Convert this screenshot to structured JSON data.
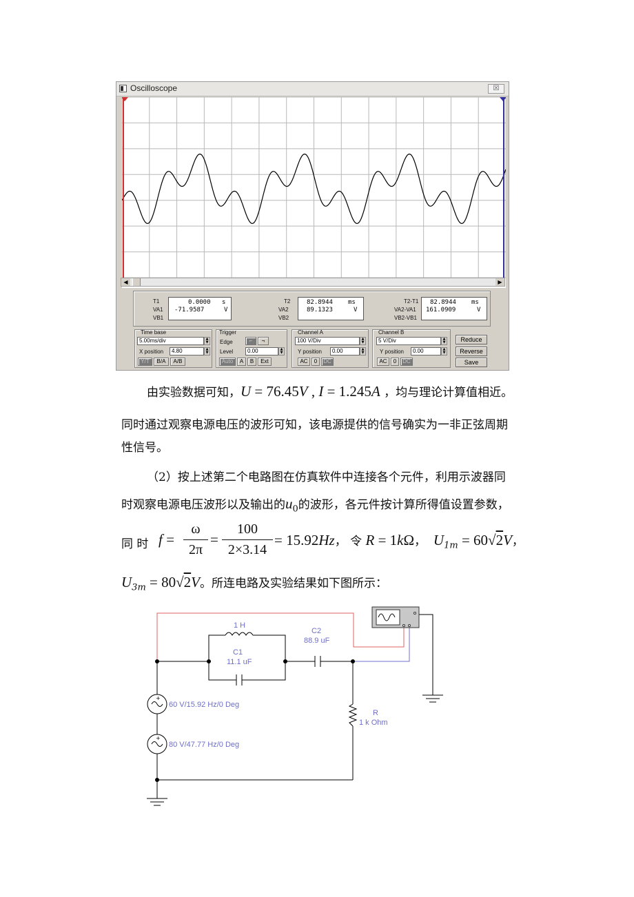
{
  "oscilloscope": {
    "title": "Oscilloscope",
    "close_glyph": "☒",
    "marker_1": "1",
    "marker_2": "2",
    "readouts": {
      "t1": {
        "label": "T1",
        "label_va": "VA1",
        "label_vb": "VB1",
        "time": "0.0000",
        "time_unit": "s",
        "va": "-71.9587",
        "va_unit": "V"
      },
      "t2": {
        "label": "T2",
        "label_va": "VA2",
        "label_vb": "VB2",
        "time": "82.8944",
        "time_unit": "ms",
        "va": "89.1323",
        "va_unit": "V"
      },
      "diff": {
        "label": "T2-T1",
        "label_va": "VA2-VA1",
        "label_vb": "VB2-VB1",
        "time": "82.8944",
        "time_unit": "ms",
        "va": "161.0909",
        "va_unit": "V"
      }
    },
    "timebase": {
      "group_label": "Time base",
      "value": "5.00ms/div",
      "xpos_label": "X position",
      "xpos_value": "4.80",
      "btn_yt": "Y/T",
      "btn_ba": "B/A",
      "btn_ab": "A/B"
    },
    "trigger": {
      "group_label": "Trigger",
      "edge_label": "Edge",
      "level_label": "Level",
      "level_value": "0.00",
      "btn_auto": "Auto",
      "btn_a": "A",
      "btn_b": "B",
      "btn_ext": "Ext"
    },
    "channel_a": {
      "group_label": "Channel A",
      "value": "100 V/Div",
      "ypos_label": "Y position",
      "ypos_value": "0.00",
      "btn_ac": "AC",
      "btn_0": "0",
      "btn_dc": "DC"
    },
    "channel_b": {
      "group_label": "Channel B",
      "value": "5 V/Div",
      "ypos_label": "Y position",
      "ypos_value": "0.00",
      "btn_ac": "AC",
      "btn_0": "0",
      "btn_dc": "DC"
    },
    "buttons": {
      "reduce": "Reduce",
      "reverse": "Reverse",
      "save": "Save"
    },
    "colors": {
      "trace": "#000000",
      "grid": "#b8b8b8",
      "cursor1": "#d03030",
      "cursor2": "#3030a0"
    }
  },
  "text": {
    "p1_a": "由实验数据可知，",
    "p1_U": "U",
    "p1_eq1": " = 76.45",
    "p1_V": "V",
    "p1_comma": " , ",
    "p1_I": "I",
    "p1_eq2": " = 1.245",
    "p1_A": "A",
    "p1_b": " ，均与理论计算值相近。",
    "p2": "同时通过观察电源电压的波形可知，该电源提供的信号确实为一非正弦周期",
    "p3": "性信号。",
    "p4": "（2）按上述第二个电路图在仿真软件中连接各个元件，利用示波器同",
    "p5_a": "时观察电源电压波形以及输出的",
    "p5_u": "u",
    "p5_sub": "0",
    "p5_b": "的波形，各元件按计算所得值设置参数，",
    "p6_a": "同 时",
    "p6_f": "f",
    "p6_eq": "=",
    "p6_omega": "ω",
    "p6_2pi": "2π",
    "p6_eq2": "=",
    "p6_100": "100",
    "p6_den": "2×3.14",
    "p6_res": "= 15.92",
    "p6_hz": "Hz",
    "p6_b": "，  令",
    "p6_R": "R",
    "p6_req": " = 1",
    "p6_k": "k",
    "p6_ohm": "Ω",
    "p6_c": "，",
    "p6_U1": "U",
    "p6_U1sub": "1m",
    "p6_U1eq": " = 60",
    "p6_sqrt": "√",
    "p6_2": "2",
    "p6_V": "V",
    "p6_d": "，",
    "p7_U3": "U",
    "p7_U3sub": "3m",
    "p7_eq": " = 80",
    "p7_sqrt": "√",
    "p7_2": "2",
    "p7_V": "V",
    "p7_b": "。所连电路及实验结果如下图所示："
  },
  "circuit": {
    "inductor": "1 H",
    "c1_name": "C1",
    "c1_value": "11.1 uF",
    "c2_name": "C2",
    "c2_value": "88.9 uF",
    "r_name": "R",
    "r_value": "1 k Ohm",
    "source1": "60 V/15.92 Hz/0 Deg",
    "source2": "80 V/47.77 Hz/0 Deg",
    "colors": {
      "wire": "#000000",
      "wire_a": "#e06060",
      "wire_b": "#7070d0",
      "label": "#6e6ec8"
    }
  }
}
